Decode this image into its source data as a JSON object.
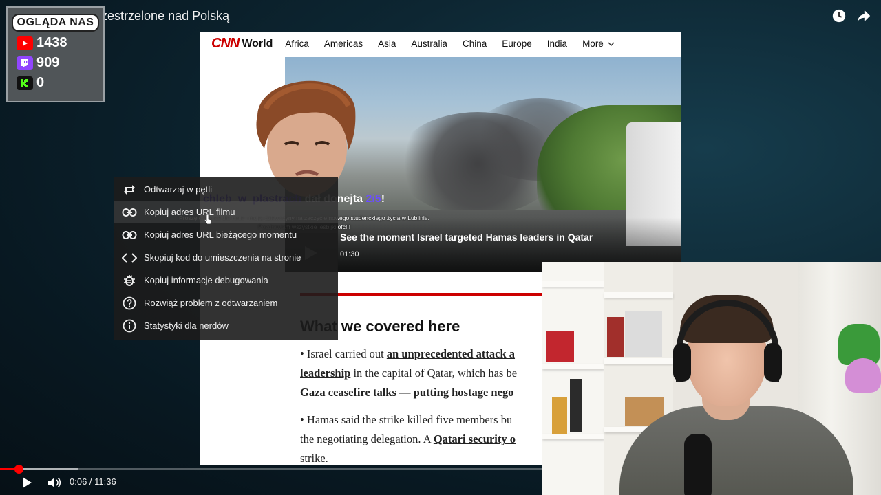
{
  "video": {
    "title": "Rosyjskie Drony zestrzelone nad Polską",
    "current_time": "0:06",
    "duration": "11:36",
    "time_display": "0:06 / 11:36",
    "progress_fraction": 0.009,
    "buffered_fraction": 0.143
  },
  "top_icons": [
    {
      "name": "clock-icon",
      "label": "Watch later"
    },
    {
      "name": "share-icon",
      "label": "Share"
    }
  ],
  "viewers": {
    "header": "OGLĄDA NAS",
    "platforms": [
      {
        "icon": "youtube-icon",
        "count": "1438",
        "color": "#ff0000"
      },
      {
        "icon": "twitch-icon",
        "count": "909",
        "color": "#9146ff"
      },
      {
        "icon": "kick-icon",
        "count": "0",
        "color": "#53fc18"
      }
    ]
  },
  "cnn": {
    "logo": "CNN",
    "section": "World",
    "nav": [
      "Africa",
      "Americas",
      "Asia",
      "Australia",
      "China",
      "Europe",
      "India"
    ],
    "more_label": "More",
    "video_caption": "See the moment Israel targeted Hamas leaders in Qatar",
    "video_duration": "01:30",
    "covered_heading": "What we covered here",
    "bullet1": {
      "pre": "• Israel carried out ",
      "link1": "an unprecedented attack a",
      "link2": "leadership",
      "mid": " in the capital of Qatar, which has be",
      "link3": "Gaza ceasefire talks",
      "dash": " — ",
      "link4": "putting hostage nego"
    },
    "bullet2": {
      "pre": "• Hamas said the strike killed five members bu",
      "line2": "the negotiating delegation. A ",
      "link1": "Qatari security o",
      "line3": "strike."
    }
  },
  "donation": {
    "donor": "chleb_w_plastrach",
    "action": " dał donejta ",
    "amount": "2i5",
    "exclaim": "!",
    "message_line1": "Proszę o błessa dla mnie i mojej dziewczyny na zaczęcie nowego studenckiego życia w Lublinie.",
    "message_line2": "Pozdrawiam wszystkie lesbijki ofc!!!"
  },
  "context_menu": {
    "items": [
      {
        "icon": "loop-icon",
        "label": "Odtwarzaj w pętli"
      },
      {
        "icon": "link-icon",
        "label": "Kopiuj adres URL filmu"
      },
      {
        "icon": "link-time-icon",
        "label": "Kopiuj adres URL bieżącego momentu"
      },
      {
        "icon": "embed-code-icon",
        "label": "Skopiuj kod do umieszczenia na stronie"
      },
      {
        "icon": "debug-bug-icon",
        "label": "Kopiuj informacje debugowania"
      },
      {
        "icon": "help-circle-icon",
        "label": "Rozwiąż problem z odtwarzaniem"
      },
      {
        "icon": "info-circle-icon",
        "label": "Statystyki dla nerdów"
      }
    ],
    "hovered_index": 1
  },
  "controls": {
    "play_icon": "play-icon",
    "volume_icon": "volume-icon"
  },
  "colors": {
    "progress": "#ff0000",
    "cnn_red": "#cc0000",
    "donor": "#7a5cff"
  }
}
